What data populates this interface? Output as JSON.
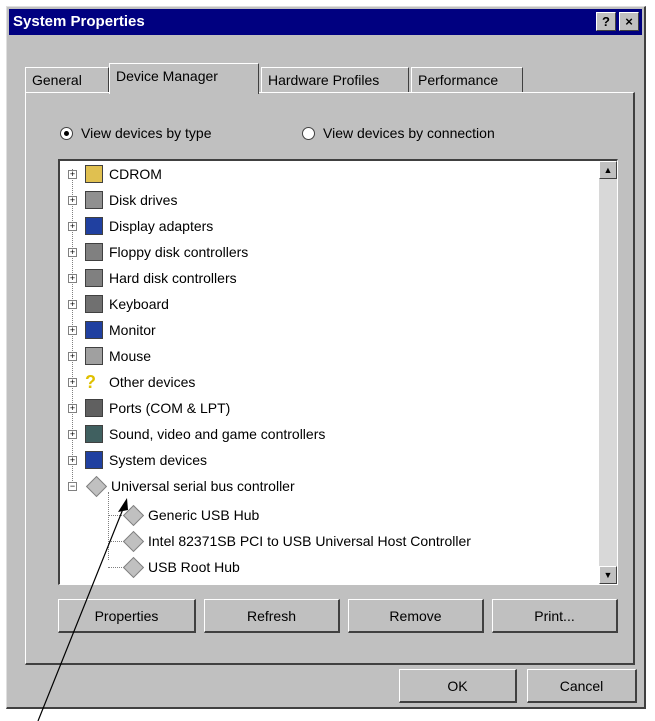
{
  "window": {
    "title": "System Properties",
    "help_label": "?",
    "close_label": "×"
  },
  "tabs": [
    "General",
    "Device Manager",
    "Hardware Profiles",
    "Performance"
  ],
  "view_options": {
    "by_type": "View devices by type",
    "by_connection": "View devices by connection",
    "selected": "by_type"
  },
  "devices": [
    {
      "label": "CDROM",
      "icon": "cdrom-icon"
    },
    {
      "label": "Disk drives",
      "icon": "disk-drive-icon"
    },
    {
      "label": "Display adapters",
      "icon": "display-adapter-icon"
    },
    {
      "label": "Floppy disk controllers",
      "icon": "floppy-controller-icon"
    },
    {
      "label": "Hard disk controllers",
      "icon": "hard-disk-controller-icon"
    },
    {
      "label": "Keyboard",
      "icon": "keyboard-icon"
    },
    {
      "label": "Monitor",
      "icon": "monitor-icon"
    },
    {
      "label": "Mouse",
      "icon": "mouse-icon"
    },
    {
      "label": "Other devices",
      "icon": "question-mark-icon"
    },
    {
      "label": "Ports (COM & LPT)",
      "icon": "port-icon"
    },
    {
      "label": "Sound, video and game controllers",
      "icon": "sound-icon"
    },
    {
      "label": "System devices",
      "icon": "system-devices-icon"
    },
    {
      "label": "Universal serial bus controller",
      "icon": "usb-controller-icon",
      "expanded": true
    }
  ],
  "usb_children": [
    "Generic USB Hub",
    "Intel 82371SB PCI to USB Universal Host Controller",
    "USB Root Hub"
  ],
  "buttons": {
    "properties": "Properties",
    "refresh": "Refresh",
    "remove": "Remove",
    "print": "Print...",
    "ok": "OK",
    "cancel": "Cancel"
  },
  "colors": {
    "titlebar": "#000080",
    "face": "#c0c0c0"
  }
}
